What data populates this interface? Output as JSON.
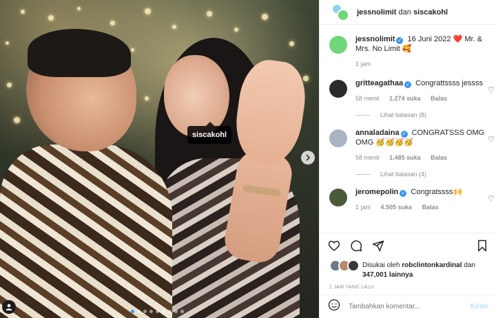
{
  "photo": {
    "tag_label": "siscakohl",
    "next_icon": "chevron-right-icon",
    "carousel_count": 9
  },
  "header": {
    "user1": "jessnolimit",
    "connector": "dan",
    "user2": "siscakohl"
  },
  "caption": {
    "username": "jessnolimit",
    "text": "16 Juni 2022 ❤️ Mr. & Mrs. No Limit 🥰",
    "time": "1 jam"
  },
  "comments": [
    {
      "username": "gritteagathaa",
      "text": "Congrattssss jessss",
      "time": "58 menit",
      "likes": "1.274 suka",
      "reply": "Balas",
      "replies_label": "Lihat balasan (8)",
      "avatar_color": "#2b2b2b"
    },
    {
      "username": "annaladaina",
      "text": "CONGRATSSS OMG OMG 🥳🥳🥳🥳",
      "time": "58 menit",
      "likes": "1.485 suka",
      "reply": "Balas",
      "replies_label": "Lihat balasan (4)",
      "avatar_color": "#a9b4c2"
    },
    {
      "username": "jeromepolin",
      "text": "Congratssss🙌",
      "time": "1 jam",
      "likes": "4.505 suka",
      "reply": "Balas",
      "avatar_color": "#4a5a3a"
    }
  ],
  "likes": {
    "prefix": "Disukai oleh",
    "user": "robclintonkardinal",
    "connector": "dan",
    "count": "347,001 lainnya"
  },
  "time_ago": "1 JAM YANG LALU",
  "composer": {
    "placeholder": "Tambahkan komentar...",
    "send_label": "Kirim"
  },
  "colors": {
    "accent": "#3897f0",
    "like_red": "#ed4956",
    "send_disabled": "#b2dffc"
  }
}
